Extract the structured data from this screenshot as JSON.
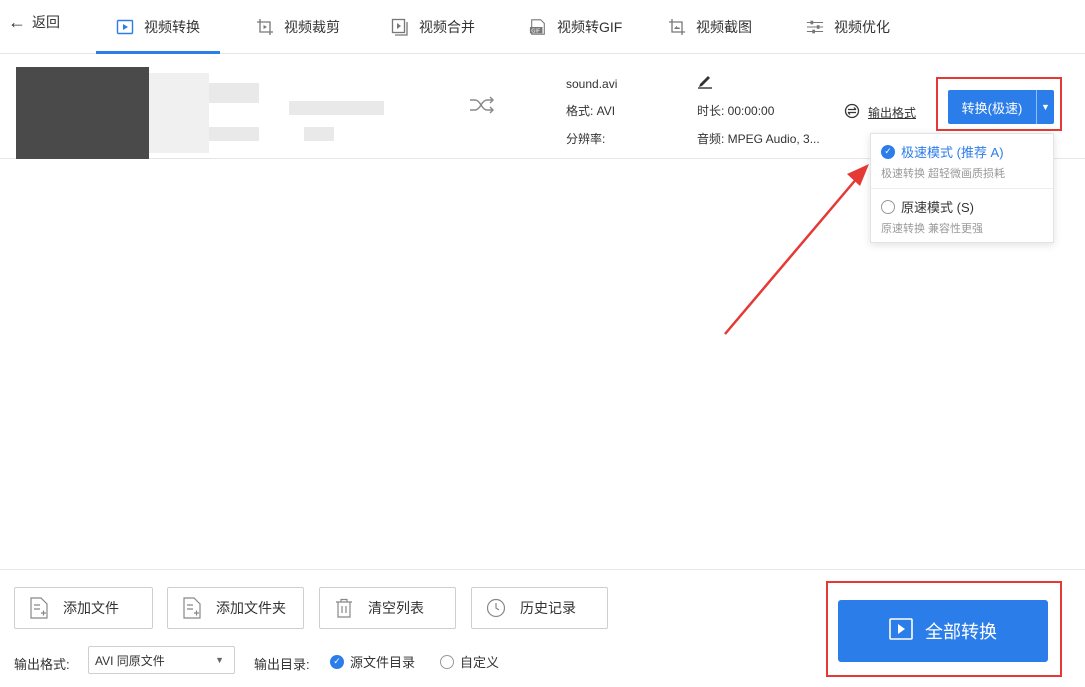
{
  "nav": {
    "back_label": "返回",
    "tabs": [
      {
        "label": "视频转换",
        "icon": "video-convert-icon",
        "active": true
      },
      {
        "label": "视频裁剪",
        "icon": "video-crop-icon"
      },
      {
        "label": "视频合并",
        "icon": "video-merge-icon"
      },
      {
        "label": "视频转GIF",
        "icon": "gif-icon"
      },
      {
        "label": "视频截图",
        "icon": "screenshot-icon"
      },
      {
        "label": "视频优化",
        "icon": "optimize-icon"
      }
    ]
  },
  "file": {
    "name": "sound.avi",
    "format": "格式: AVI",
    "resolution": "分辨率:",
    "duration": "时长: 00:00:00",
    "audio": "音频: MPEG Audio, 3...",
    "output_format_label": "输出格式"
  },
  "convert": {
    "button_label": "转换(极速)",
    "options": [
      {
        "title": "极速模式 (推荐 A)",
        "subtitle": "极速转换 超轻微画质损耗",
        "selected": true
      },
      {
        "title": "原速模式 (S)",
        "subtitle": "原速转换 兼容性更强",
        "selected": false
      }
    ]
  },
  "bottom": {
    "add_file": "添加文件",
    "add_folder": "添加文件夹",
    "clear_list": "清空列表",
    "history": "历史记录",
    "output_format_label": "输出格式:",
    "output_format_value": "AVI 同原文件",
    "output_dir_label": "输出目录:",
    "dir_source": "源文件目录",
    "dir_custom": "自定义",
    "convert_all": "全部转换"
  },
  "colors": {
    "accent": "#2b7de9",
    "highlight": "#e53935"
  }
}
